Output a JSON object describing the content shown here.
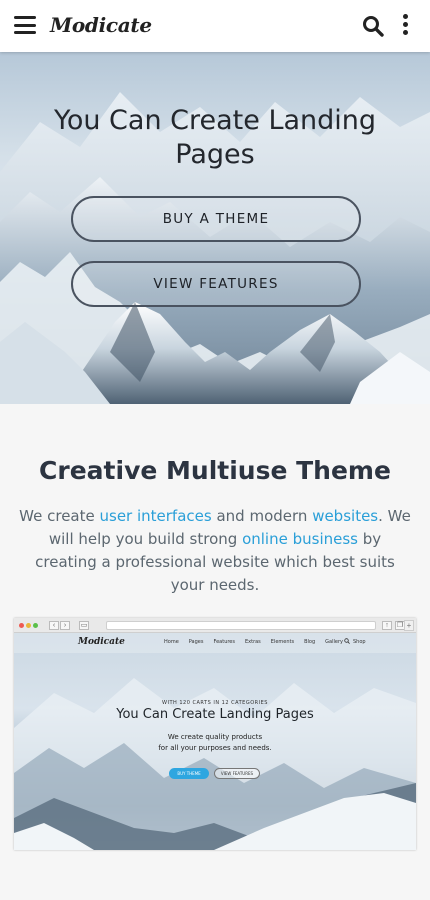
{
  "header": {
    "logo": "Modicate",
    "menu_icon": "hamburger-menu-icon",
    "search_icon": "search-icon",
    "more_icon": "more-vertical-icon"
  },
  "hero": {
    "title": "You Can Create Landing Pages",
    "buy_label": "BUY A THEME",
    "features_label": "VIEW FEATURES"
  },
  "section": {
    "title": "Creative Multiuse Theme",
    "text_1": "We create ",
    "link_1": "user interfaces",
    "text_2": " and modern ",
    "link_2": "websites",
    "text_3": ". We will help you build strong ",
    "link_3": "online business",
    "text_4": " by creating a professional website which best suits your needs.",
    "link_color": "#2a9fd8"
  },
  "mockup": {
    "logo": "Modicate",
    "menu": [
      "Home",
      "Pages",
      "Features",
      "Extras",
      "Elements",
      "Blog",
      "Gallery",
      "Shop"
    ],
    "kicker": "WITH 120 CARTS IN 12 CATEGORIES",
    "title": "You Can Create Landing Pages",
    "subtitle_1": "We create quality products",
    "subtitle_2": "for all your purposes and needs.",
    "button_1": "BUY THEME",
    "button_2": "VIEW FEATURES"
  }
}
